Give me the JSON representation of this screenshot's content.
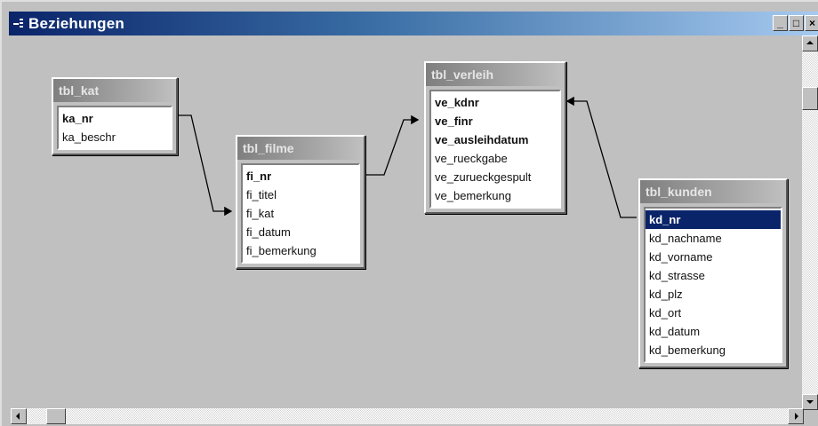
{
  "window": {
    "title": "Beziehungen",
    "caption_buttons": {
      "minimize": "_",
      "restore": "□",
      "close": "×"
    }
  },
  "tables": [
    {
      "name": "tbl_kat",
      "fields": [
        {
          "label": "ka_nr",
          "key": true
        },
        {
          "label": "ka_beschr",
          "key": false
        }
      ]
    },
    {
      "name": "tbl_filme",
      "fields": [
        {
          "label": "fi_nr",
          "key": true
        },
        {
          "label": "fi_titel",
          "key": false
        },
        {
          "label": "fi_kat",
          "key": false
        },
        {
          "label": "fi_datum",
          "key": false
        },
        {
          "label": "fi_bemerkung",
          "key": false
        }
      ]
    },
    {
      "name": "tbl_verleih",
      "fields": [
        {
          "label": "ve_kdnr",
          "key": true
        },
        {
          "label": "ve_finr",
          "key": true
        },
        {
          "label": "ve_ausleihdatum",
          "key": true
        },
        {
          "label": "ve_rueckgabe",
          "key": false
        },
        {
          "label": "ve_zurueckgespult",
          "key": false
        },
        {
          "label": "ve_bemerkung",
          "key": false
        }
      ]
    },
    {
      "name": "tbl_kunden",
      "fields": [
        {
          "label": "kd_nr",
          "key": true,
          "selected": true
        },
        {
          "label": "kd_nachname",
          "key": false
        },
        {
          "label": "kd_vorname",
          "key": false
        },
        {
          "label": "kd_strasse",
          "key": false
        },
        {
          "label": "kd_plz",
          "key": false
        },
        {
          "label": "kd_ort",
          "key": false
        },
        {
          "label": "kd_datum",
          "key": false
        },
        {
          "label": "kd_bemerkung",
          "key": false
        }
      ]
    }
  ],
  "relationships": [
    {
      "from": "tbl_kat.ka_nr",
      "to": "tbl_filme.fi_kat"
    },
    {
      "from": "tbl_filme.fi_nr",
      "to": "tbl_verleih.ve_finr"
    },
    {
      "from": "tbl_kunden.kd_nr",
      "to": "tbl_verleih.ve_kdnr"
    }
  ],
  "colors": {
    "title_gradient_start": "#0a246a",
    "title_gradient_end": "#a6caf0",
    "selection": "#0a246a",
    "workspace": "#c0c0c0"
  }
}
